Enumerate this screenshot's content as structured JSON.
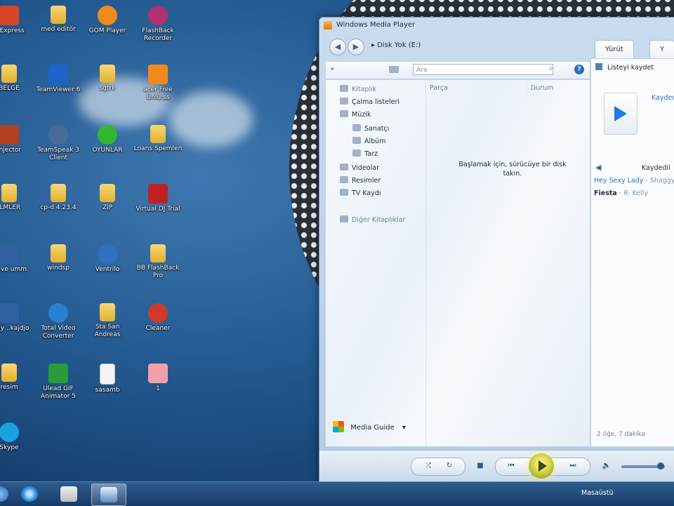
{
  "desktop": {
    "icons": [
      {
        "label": "o Express",
        "kind": "app",
        "color": "#d9442a"
      },
      {
        "label": "med editör",
        "kind": "folder",
        "color": "#e9c24a"
      },
      {
        "label": "GOM Player",
        "kind": "round",
        "color": "#f08a1c"
      },
      {
        "label": "FlashBack Recorder",
        "kind": "round",
        "color": "#b03070"
      },
      {
        "label": "BELGE",
        "kind": "folder",
        "color": "#e9c24a"
      },
      {
        "label": "TeamViewer 6",
        "kind": "app",
        "color": "#1e64c8"
      },
      {
        "label": "sgtrk",
        "kind": "folder",
        "color": "#e9c24a"
      },
      {
        "label": "acer Free Ünlü.ss",
        "kind": "app",
        "color": "#f08a1c"
      },
      {
        "label": "Injector",
        "kind": "app",
        "color": "#b04020"
      },
      {
        "label": "TeamSpeak 3 Client",
        "kind": "round",
        "color": "#4a6b9a"
      },
      {
        "label": "OYUNLAR",
        "kind": "round",
        "color": "#2fb82f"
      },
      {
        "label": "Loans Spemlen",
        "kind": "folder",
        "color": "#e9c24a"
      },
      {
        "label": "ILMLER",
        "kind": "folder",
        "color": "#e9c24a"
      },
      {
        "label": "cp-d 4.23.4",
        "kind": "folder",
        "color": "#e9c24a"
      },
      {
        "label": "ZİP",
        "kind": "folder",
        "color": "#e9c24a"
      },
      {
        "label": "Virtual DJ Trial",
        "kind": "app",
        "color": "#c02020"
      },
      {
        "label": "s.ave umm",
        "kind": "app",
        "color": "#3060a0"
      },
      {
        "label": "windsp",
        "kind": "folder",
        "color": "#e9c24a"
      },
      {
        "label": "Ventrilo",
        "kind": "round",
        "color": "#3070c0"
      },
      {
        "label": "BB FlashBack Pro",
        "kind": "folder",
        "color": "#e9c24a"
      },
      {
        "label": "ilday ..kajdjo",
        "kind": "app",
        "color": "#3060a0"
      },
      {
        "label": "Total Video Converter",
        "kind": "round",
        "color": "#2a80d0"
      },
      {
        "label": "Sta San Andreas",
        "kind": "folder",
        "color": "#e9c24a"
      },
      {
        "label": "Cleaner",
        "kind": "round",
        "color": "#d03a2a"
      },
      {
        "label": "resim",
        "kind": "folder",
        "color": "#e9c24a"
      },
      {
        "label": "Ulead GIF Animator 5",
        "kind": "app",
        "color": "#2a9a3a"
      },
      {
        "label": "sasamb",
        "kind": "doc",
        "color": "#f4f4f4"
      },
      {
        "label": "1",
        "kind": "app",
        "color": "#f0a0a8"
      },
      {
        "label": "Skype",
        "kind": "round",
        "color": "#1aa1e1"
      }
    ]
  },
  "wmp": {
    "title": "Windows Media Player",
    "nav": {
      "back": "◀",
      "forward": "▶",
      "breadcrumb_arrow": "▸",
      "breadcrumb": "Disk Yok (E:)"
    },
    "tabs": [
      "Yürüt",
      "Y"
    ],
    "toolbar": {
      "expand": "»",
      "search_placeholder": "Ara",
      "search_icon": "search-icon",
      "help": "?"
    },
    "library_nav": [
      {
        "label": "Kitaplık",
        "indent": 0,
        "dim": true
      },
      {
        "label": "Çalma listeleri",
        "indent": 0,
        "dim": false
      },
      {
        "label": "Müzik",
        "indent": 0,
        "dim": false
      },
      {
        "label": "Sanatçı",
        "indent": 1,
        "dim": false
      },
      {
        "label": "Albüm",
        "indent": 1,
        "dim": false
      },
      {
        "label": "Tarz",
        "indent": 1,
        "dim": false
      },
      {
        "label": "Videolar",
        "indent": 0,
        "dim": false
      },
      {
        "label": "Resimler",
        "indent": 0,
        "dim": false
      },
      {
        "label": "TV Kaydı",
        "indent": 0,
        "dim": false
      },
      {
        "label": "Diğer Kitaplıklar",
        "indent": 0,
        "dim": true
      }
    ],
    "columns": [
      "Parça",
      "Durum"
    ],
    "empty_message": "Başlamak için, sürücüye bir disk takın.",
    "media_guide": "Media Guide",
    "media_guide_arrow": "▾",
    "right_pane": {
      "save_list": "Listeyi kaydet",
      "header_link": "Kaydedi",
      "back": "◀",
      "section_label": "Kaydedil",
      "tracks": [
        {
          "title": "Hey Sexy Lady",
          "sep": " - ",
          "artist": "Shaggy",
          "color": "#2f6cc0"
        },
        {
          "title": "Fiesta",
          "sep": " - ",
          "artist": "R. Kelly",
          "color": "#1d2b3a"
        }
      ],
      "status": "2 öğe, 7 dakika"
    },
    "controls": {
      "shuffle": "⤮",
      "repeat": "↻",
      "stop": "■",
      "prev": "⏮",
      "next": "⏭",
      "mute": "🔈",
      "volume": 0.9
    }
  },
  "taskbar": {
    "show_desktop_label": "Masaüstü",
    "items": [
      {
        "name": "start-orb",
        "color": "#3b7fd0"
      },
      {
        "name": "internet-explorer",
        "color": "#1e88e5"
      },
      {
        "name": "counter-strike",
        "color": "#e0e0e0"
      },
      {
        "name": "windows-media-player",
        "color": "#5b8cc0"
      }
    ]
  }
}
